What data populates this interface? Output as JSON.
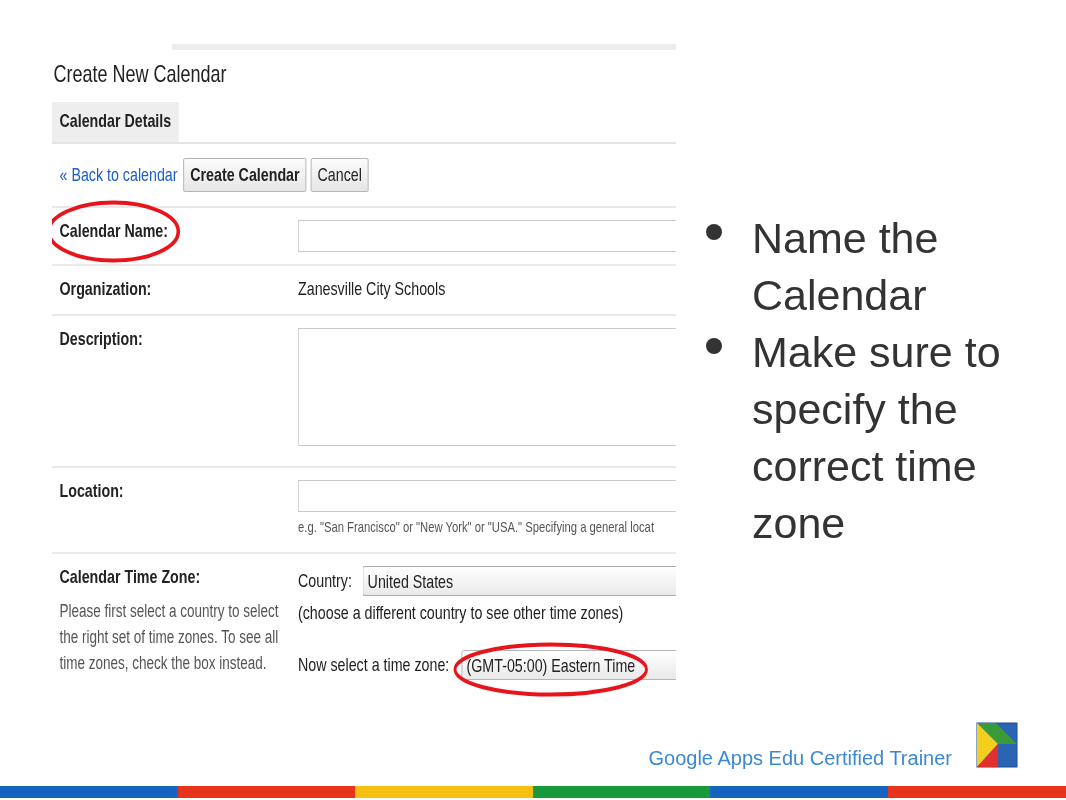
{
  "calendar_form": {
    "title": "Create New Calendar",
    "tab": {
      "label": "Calendar Details",
      "selected": true
    },
    "back_link": "« Back to calendar",
    "buttons": [
      {
        "label": "Create Calendar",
        "primary": true
      },
      {
        "label": "Cancel",
        "primary": false
      }
    ],
    "fields": [
      {
        "kind": "input",
        "label": "Calendar Name:",
        "highlighted": true
      },
      {
        "kind": "text",
        "label": "Organization:",
        "value": "Zanesville City Schools"
      },
      {
        "kind": "textarea",
        "label": "Description:"
      },
      {
        "kind": "input",
        "label": "Location:",
        "hint": "e.g. \"San Francisco\" or \"New York\" or \"USA.\" Specifying a general locat"
      },
      {
        "kind": "timezone",
        "label": "Calendar Time Zone:",
        "description": "Please first select a country to select the right set of time zones. To see all time zones, check the box instead.",
        "country_label": "Country:",
        "country": "United States",
        "country_hint": "(choose a different country to see other time zones)",
        "zone_label": "Now select a time zone:",
        "zone": "(GMT-05:00) Eastern Time",
        "highlighted": true
      }
    ]
  },
  "bullets": [
    "Name the Calendar",
    "Make sure to specify the correct time zone"
  ],
  "footer": {
    "text": "Google Apps Edu Certified Trainer"
  }
}
